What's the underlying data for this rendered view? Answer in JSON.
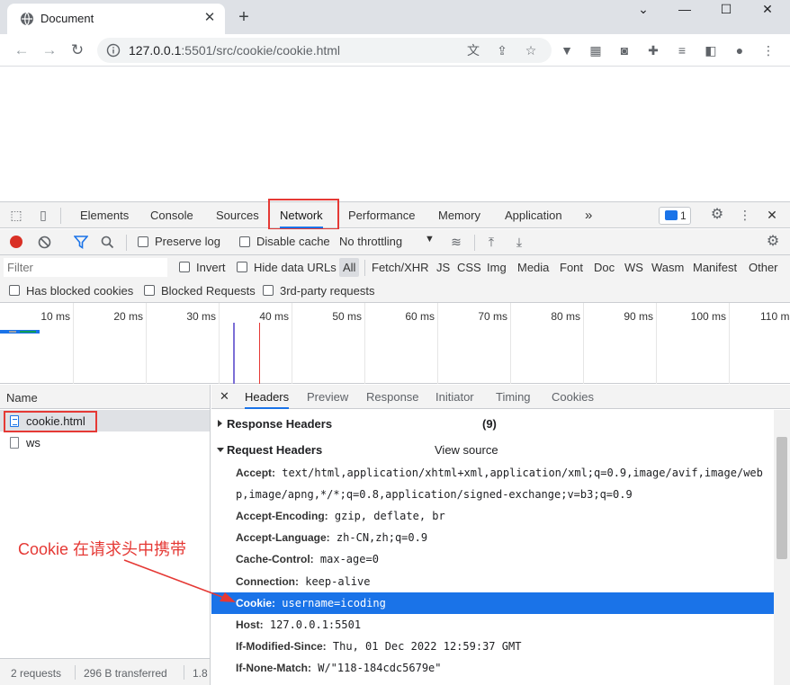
{
  "browser": {
    "tab_title": "Document",
    "url_host": "127.0.0.1",
    "url_rest": ":5501/src/cookie/cookie.html"
  },
  "devtools": {
    "tabs": [
      "Elements",
      "Console",
      "Sources",
      "Network",
      "Performance",
      "Memory",
      "Application"
    ],
    "active_tab": "Network",
    "issues_count": "1",
    "more_label": "»",
    "toolbar": {
      "preserve_log": "Preserve log",
      "disable_cache": "Disable cache",
      "throttling": "No throttling"
    },
    "filter": {
      "placeholder": "Filter",
      "invert": "Invert",
      "hide_data_urls": "Hide data URLs",
      "types": [
        "All",
        "Fetch/XHR",
        "JS",
        "CSS",
        "Img",
        "Media",
        "Font",
        "Doc",
        "WS",
        "Wasm",
        "Manifest",
        "Other"
      ],
      "has_blocked_cookies": "Has blocked cookies",
      "blocked_requests": "Blocked Requests",
      "third_party": "3rd-party requests"
    },
    "timeline_ticks": [
      "10 ms",
      "20 ms",
      "30 ms",
      "40 ms",
      "50 ms",
      "60 ms",
      "70 ms",
      "80 ms",
      "90 ms",
      "100 ms",
      "110 ms"
    ],
    "requests": {
      "column_name": "Name",
      "items": [
        "cookie.html",
        "ws"
      ],
      "status": "2 requests",
      "transferred": "296 B transferred",
      "extra": "1.8"
    },
    "detail": {
      "tabs": [
        "Headers",
        "Preview",
        "Response",
        "Initiator",
        "Timing",
        "Cookies"
      ],
      "response_headers_label": "Response Headers",
      "response_headers_count": "(9)",
      "request_headers_label": "Request Headers",
      "view_source": "View source",
      "headers": [
        {
          "name": "Accept:",
          "value": "text/html,application/xhtml+xml,application/xml;q=0.9,image/avif,image/web"
        },
        {
          "name": "",
          "value": "p,image/apng,*/*;q=0.8,application/signed-exchange;v=b3;q=0.9"
        },
        {
          "name": "Accept-Encoding:",
          "value": "gzip, deflate, br"
        },
        {
          "name": "Accept-Language:",
          "value": "zh-CN,zh;q=0.9"
        },
        {
          "name": "Cache-Control:",
          "value": "max-age=0"
        },
        {
          "name": "Connection:",
          "value": "keep-alive"
        },
        {
          "name": "Cookie:",
          "value": "username=icoding"
        },
        {
          "name": "Host:",
          "value": "127.0.0.1:5501"
        },
        {
          "name": "If-Modified-Since:",
          "value": "Thu, 01 Dec 2022 12:59:37 GMT"
        },
        {
          "name": "If-None-Match:",
          "value": "W/\"118-184cdc5679e\""
        }
      ]
    }
  },
  "annotation": {
    "text": "Cookie 在请求头中携带",
    "color": "#e53935"
  },
  "colors": {
    "accent": "#1a73e8",
    "record": "#d93025",
    "highlight": "#e53935"
  }
}
